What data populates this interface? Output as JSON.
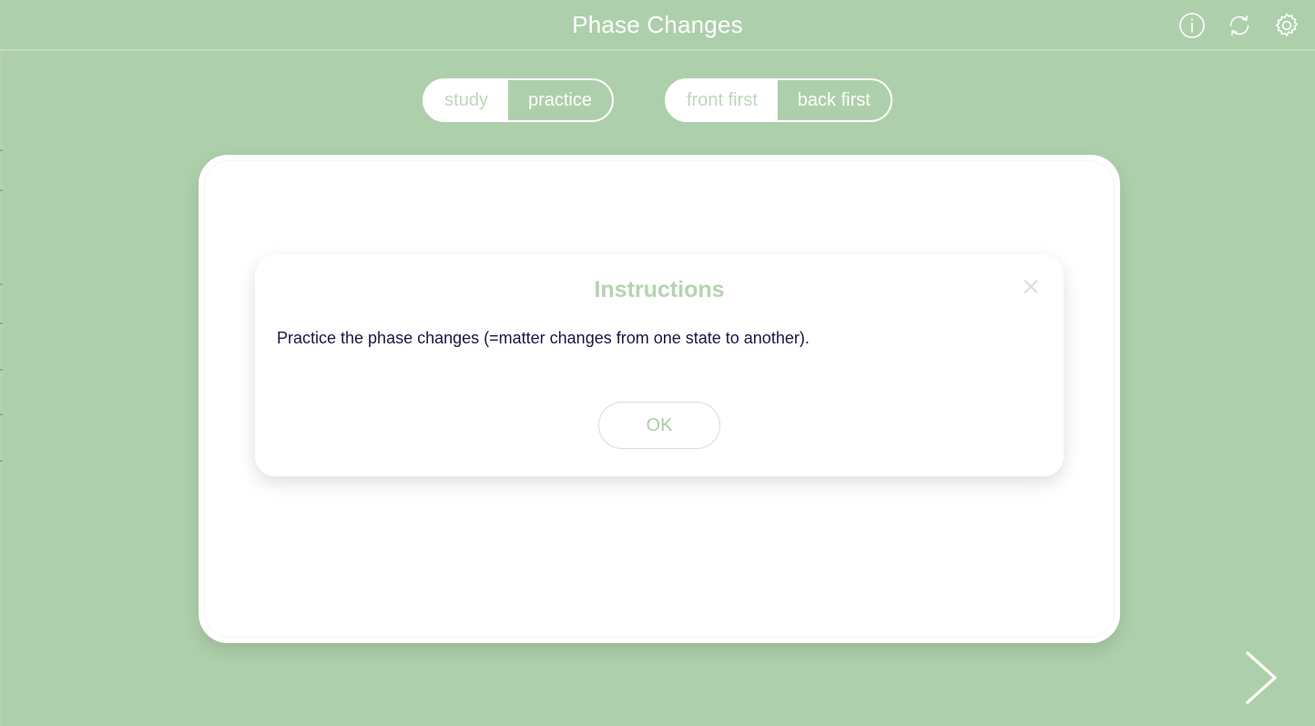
{
  "header": {
    "title": "Phase Changes",
    "actions": [
      {
        "name": "info-icon",
        "label": "info"
      },
      {
        "name": "shuffle-icon",
        "label": "shuffle"
      },
      {
        "name": "gear-icon",
        "label": "settings"
      }
    ]
  },
  "mode_toggle": {
    "name": "study-practice-toggle",
    "options": [
      {
        "label": "study",
        "selected": false
      },
      {
        "label": "practice",
        "selected": true
      }
    ]
  },
  "order_toggle": {
    "name": "front-back-toggle",
    "options": [
      {
        "label": "front first",
        "selected": false
      },
      {
        "label": "back first",
        "selected": true
      }
    ]
  },
  "dialog": {
    "title": "Instructions",
    "body": "Practice the phase changes (=matter changes from one state to another).",
    "ok_label": "OK",
    "close_label": "×"
  },
  "navigation": {
    "next_label": "next"
  },
  "colors": {
    "background": "#aecfab",
    "header": "#aecfab",
    "card": "#ffffff",
    "accent_green": "#b4d4b0",
    "toggle_inactive_text": "#bcd9b8",
    "body_text": "#181844",
    "ok_text": "#a9cda5"
  }
}
